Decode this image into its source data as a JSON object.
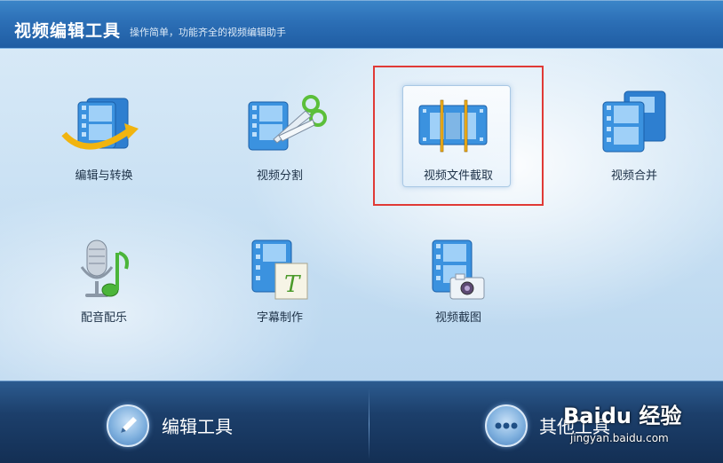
{
  "header": {
    "title": "视频编辑工具",
    "subtitle": "操作简单，功能齐全的视频编辑助手"
  },
  "tools": [
    {
      "label": "编辑与转换",
      "icon": "film-convert-icon"
    },
    {
      "label": "视频分割",
      "icon": "film-scissors-icon"
    },
    {
      "label": "视频文件截取",
      "icon": "film-clip-icon",
      "selected": true
    },
    {
      "label": "视频合并",
      "icon": "film-merge-icon"
    },
    {
      "label": "配音配乐",
      "icon": "microphone-music-icon"
    },
    {
      "label": "字幕制作",
      "icon": "film-text-icon"
    },
    {
      "label": "视频截图",
      "icon": "film-camera-icon"
    }
  ],
  "bottom": {
    "edit_tools_label": "编辑工具",
    "other_tools_label": "其他工具"
  },
  "watermark": {
    "logo_text": "Baidu 经验",
    "url_text": "jingyan.baidu.com"
  },
  "colors": {
    "header_blue": "#2c6fb6",
    "bottom_navy": "#1c3f6b",
    "highlight_red": "#e03a36",
    "film_blue": "#2e7fd0"
  }
}
